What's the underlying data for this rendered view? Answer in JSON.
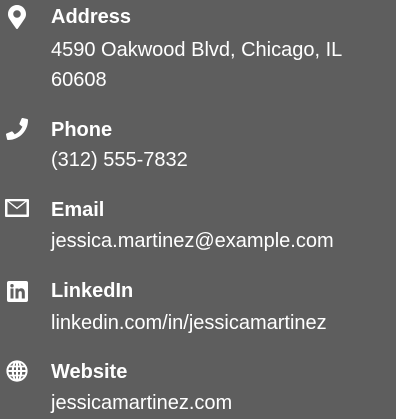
{
  "theme": {
    "background": "#5e5e5e",
    "text": "#ffffff"
  },
  "contact": {
    "address": {
      "icon": "map-marker-icon",
      "label": "Address",
      "value": "4590 Oakwood Blvd, Chicago, IL 60608"
    },
    "phone": {
      "icon": "phone-icon",
      "label": "Phone",
      "value": "(312) 555-7832"
    },
    "email": {
      "icon": "envelope-icon",
      "label": "Email",
      "value": "jessica.martinez@example.com"
    },
    "linkedin": {
      "icon": "linkedin-icon",
      "label": "LinkedIn",
      "value": "linkedin.com/in/jessicamartinez"
    },
    "website": {
      "icon": "globe-icon",
      "label": "Website",
      "value": "jessicamartinez.com"
    }
  }
}
